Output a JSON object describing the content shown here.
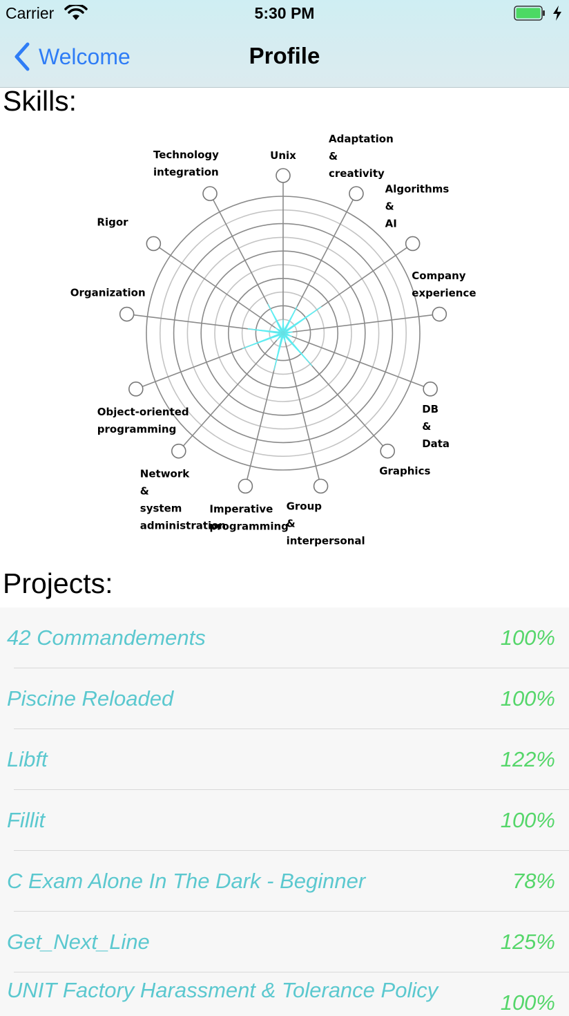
{
  "status_bar": {
    "carrier": "Carrier",
    "time": "5:30 PM",
    "battery_color": "#4cd964"
  },
  "nav": {
    "back_label": "Welcome",
    "title": "Profile",
    "accent": "#2f7df6"
  },
  "skills": {
    "title": "Skills:",
    "chart_data": {
      "type": "radar",
      "rings": 10,
      "fill_color": "#5ef0f5",
      "axes": [
        {
          "lines": [
            "Unix"
          ],
          "value": 1.0
        },
        {
          "lines": [
            "Adaptation",
            "&",
            "creativity"
          ],
          "value": 2.2
        },
        {
          "lines": [
            "Algorithms",
            "&",
            "AI"
          ],
          "value": 3.4
        },
        {
          "lines": [
            "Company",
            "experience"
          ],
          "value": 0.7
        },
        {
          "lines": [
            "DB",
            "&",
            "Data"
          ],
          "value": 0.7
        },
        {
          "lines": [
            "Graphics"
          ],
          "value": 3.2
        },
        {
          "lines": [
            "Group",
            "&",
            "interpersonal"
          ],
          "value": 0.7
        },
        {
          "lines": [
            "Imperative",
            "programming"
          ],
          "value": 2.8
        },
        {
          "lines": [
            "Network",
            "&",
            "system",
            "administration"
          ],
          "value": 0.7
        },
        {
          "lines": [
            "Object-oriented",
            "programming"
          ],
          "value": 3.2
        },
        {
          "lines": [
            "Organization"
          ],
          "value": 2.6
        },
        {
          "lines": [
            "Rigor"
          ],
          "value": 0.7
        },
        {
          "lines": [
            "Technology",
            "integration"
          ],
          "value": 2.4
        }
      ]
    }
  },
  "projects": {
    "title": "Projects:",
    "name_color": "#5bc8cf",
    "value_color": "#55d66a",
    "items": [
      {
        "name": "42 Commandements",
        "value": "100%"
      },
      {
        "name": "Piscine Reloaded",
        "value": "100%"
      },
      {
        "name": "Libft",
        "value": "122%"
      },
      {
        "name": "Fillit",
        "value": "100%"
      },
      {
        "name": "C Exam Alone In The Dark - Beginner",
        "value": "78%"
      },
      {
        "name": "Get_Next_Line",
        "value": "125%"
      },
      {
        "name": "UNIT Factory Harassment & Tolerance Policy",
        "value": "100%"
      }
    ]
  }
}
